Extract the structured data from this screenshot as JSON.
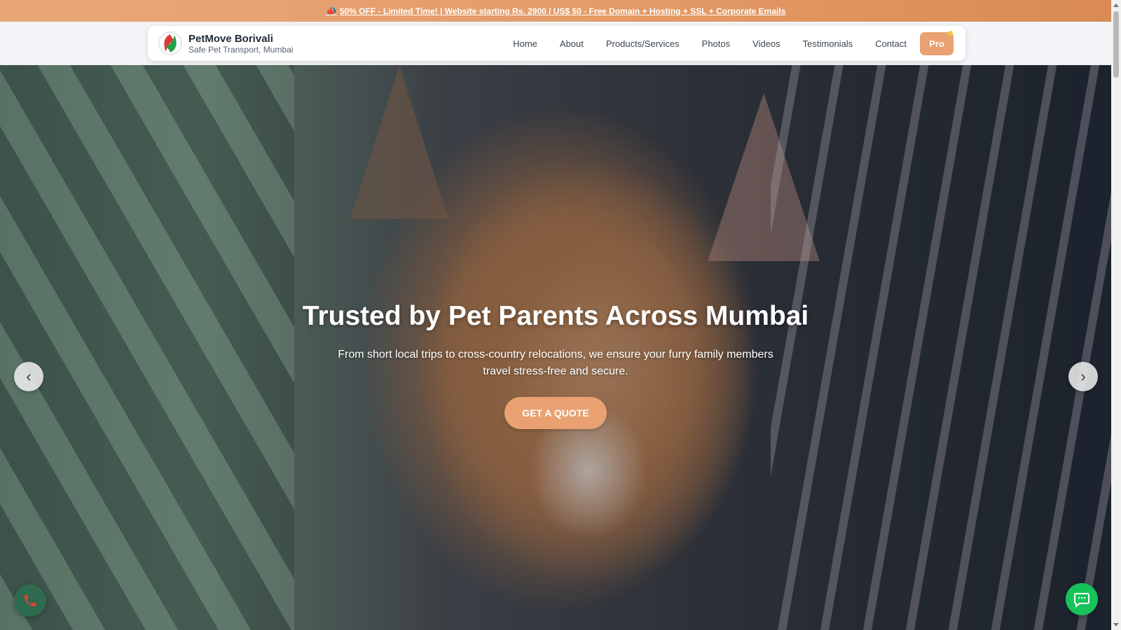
{
  "promo": {
    "icon": "megaphone-icon",
    "icon_glyph": "📣",
    "text": "50% OFF - Limited Time! | Website starting Rs. 2900 / US$ 50 - Free Domain + Hosting + SSL + Corporate Emails"
  },
  "brand": {
    "name": "PetMove Borivali",
    "tagline": "Safe Pet Transport, Mumbai",
    "logo_colors": [
      "#d83a3a",
      "#22a447"
    ]
  },
  "nav": {
    "items": [
      {
        "label": "Home"
      },
      {
        "label": "About"
      },
      {
        "label": "Products/Services"
      },
      {
        "label": "Photos"
      },
      {
        "label": "Videos"
      },
      {
        "label": "Testimonials"
      },
      {
        "label": "Contact"
      }
    ],
    "pro_label": "Pro"
  },
  "hero": {
    "title": "Trusted by Pet Parents Across Mumbai",
    "subtitle": "From short local trips to cross-country relocations, we ensure your furry family members travel stress-free and secure.",
    "cta_label": "GET A QUOTE",
    "prev_glyph": "‹",
    "next_glyph": "›"
  },
  "floating": {
    "call_icon": "phone-icon",
    "chat_icon": "chat-bubble-icon"
  },
  "colors": {
    "accent": "#e9a171",
    "promo_bar": "#e39a66",
    "chat_green": "#16c25a",
    "call_green": "#2e6b4f",
    "phone_red": "#e0413a"
  }
}
